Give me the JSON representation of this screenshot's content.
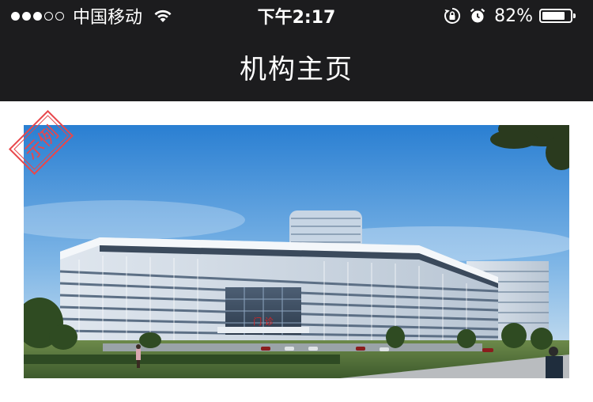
{
  "status_bar": {
    "signal_filled": 3,
    "signal_total": 5,
    "carrier": "中国移动",
    "wifi_icon": "wifi-icon",
    "time": "下午2:17",
    "rotation_lock_icon": "rotation-lock-icon",
    "alarm_icon": "alarm-icon",
    "battery_percent": "82%",
    "battery_level": 0.82
  },
  "nav": {
    "title": "机构主页"
  },
  "banner": {
    "image": "hospital-building-rendering",
    "building_sign": "门 诊",
    "watermark": "示例"
  },
  "colors": {
    "bar_bg": "#1c1c1e",
    "watermark_red": "#e8474b"
  }
}
